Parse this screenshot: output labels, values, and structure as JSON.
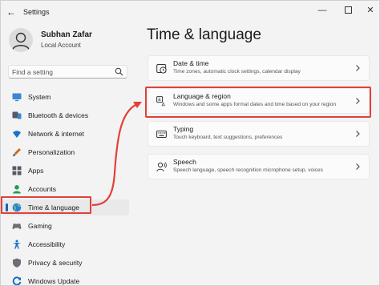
{
  "window": {
    "app_title": "Settings",
    "back_icon": "back-arrow-icon",
    "controls": [
      "minimize-icon",
      "maximize-icon",
      "close-icon"
    ]
  },
  "profile": {
    "name": "Subhan Zafar",
    "account": "Local Account"
  },
  "search": {
    "placeholder": "Find a setting",
    "value": ""
  },
  "sidebar": {
    "items": [
      {
        "label": "System",
        "icon": "monitor-icon",
        "color": "#0a66c2"
      },
      {
        "label": "Bluetooth & devices",
        "icon": "bluetooth-icon",
        "color": "#0a66c2"
      },
      {
        "label": "Network & internet",
        "icon": "wifi-icon",
        "color": "#1a73c9"
      },
      {
        "label": "Personalization",
        "icon": "brush-icon",
        "color": "#c76b1b"
      },
      {
        "label": "Apps",
        "icon": "apps-icon",
        "color": "#555a66"
      },
      {
        "label": "Accounts",
        "icon": "person-icon",
        "color": "#1f9e55"
      },
      {
        "label": "Time & language",
        "icon": "globe-clock-icon",
        "color": "#0a66c2"
      },
      {
        "label": "Gaming",
        "icon": "gamepad-icon",
        "color": "#6b6f77"
      },
      {
        "label": "Accessibility",
        "icon": "accessibility-icon",
        "color": "#1a73c9"
      },
      {
        "label": "Privacy & security",
        "icon": "shield-icon",
        "color": "#6b6f77"
      },
      {
        "label": "Windows Update",
        "icon": "refresh-icon",
        "color": "#0a66c2"
      }
    ],
    "active_index": 6
  },
  "main": {
    "title": "Time & language",
    "cards": [
      {
        "title": "Date & time",
        "subtitle": "Time zones, automatic clock settings, calendar display",
        "icon": "clock-icon"
      },
      {
        "title": "Language & region",
        "subtitle": "Windows and some apps format dates and time based on your region",
        "icon": "language-icon"
      },
      {
        "title": "Typing",
        "subtitle": "Touch keyboard, text suggestions, preferences",
        "icon": "keyboard-icon"
      },
      {
        "title": "Speech",
        "subtitle": "Speech language, speech recognition microphone setup, voices",
        "icon": "speech-icon"
      }
    ]
  },
  "annotation": {
    "color": "#e2403a"
  }
}
